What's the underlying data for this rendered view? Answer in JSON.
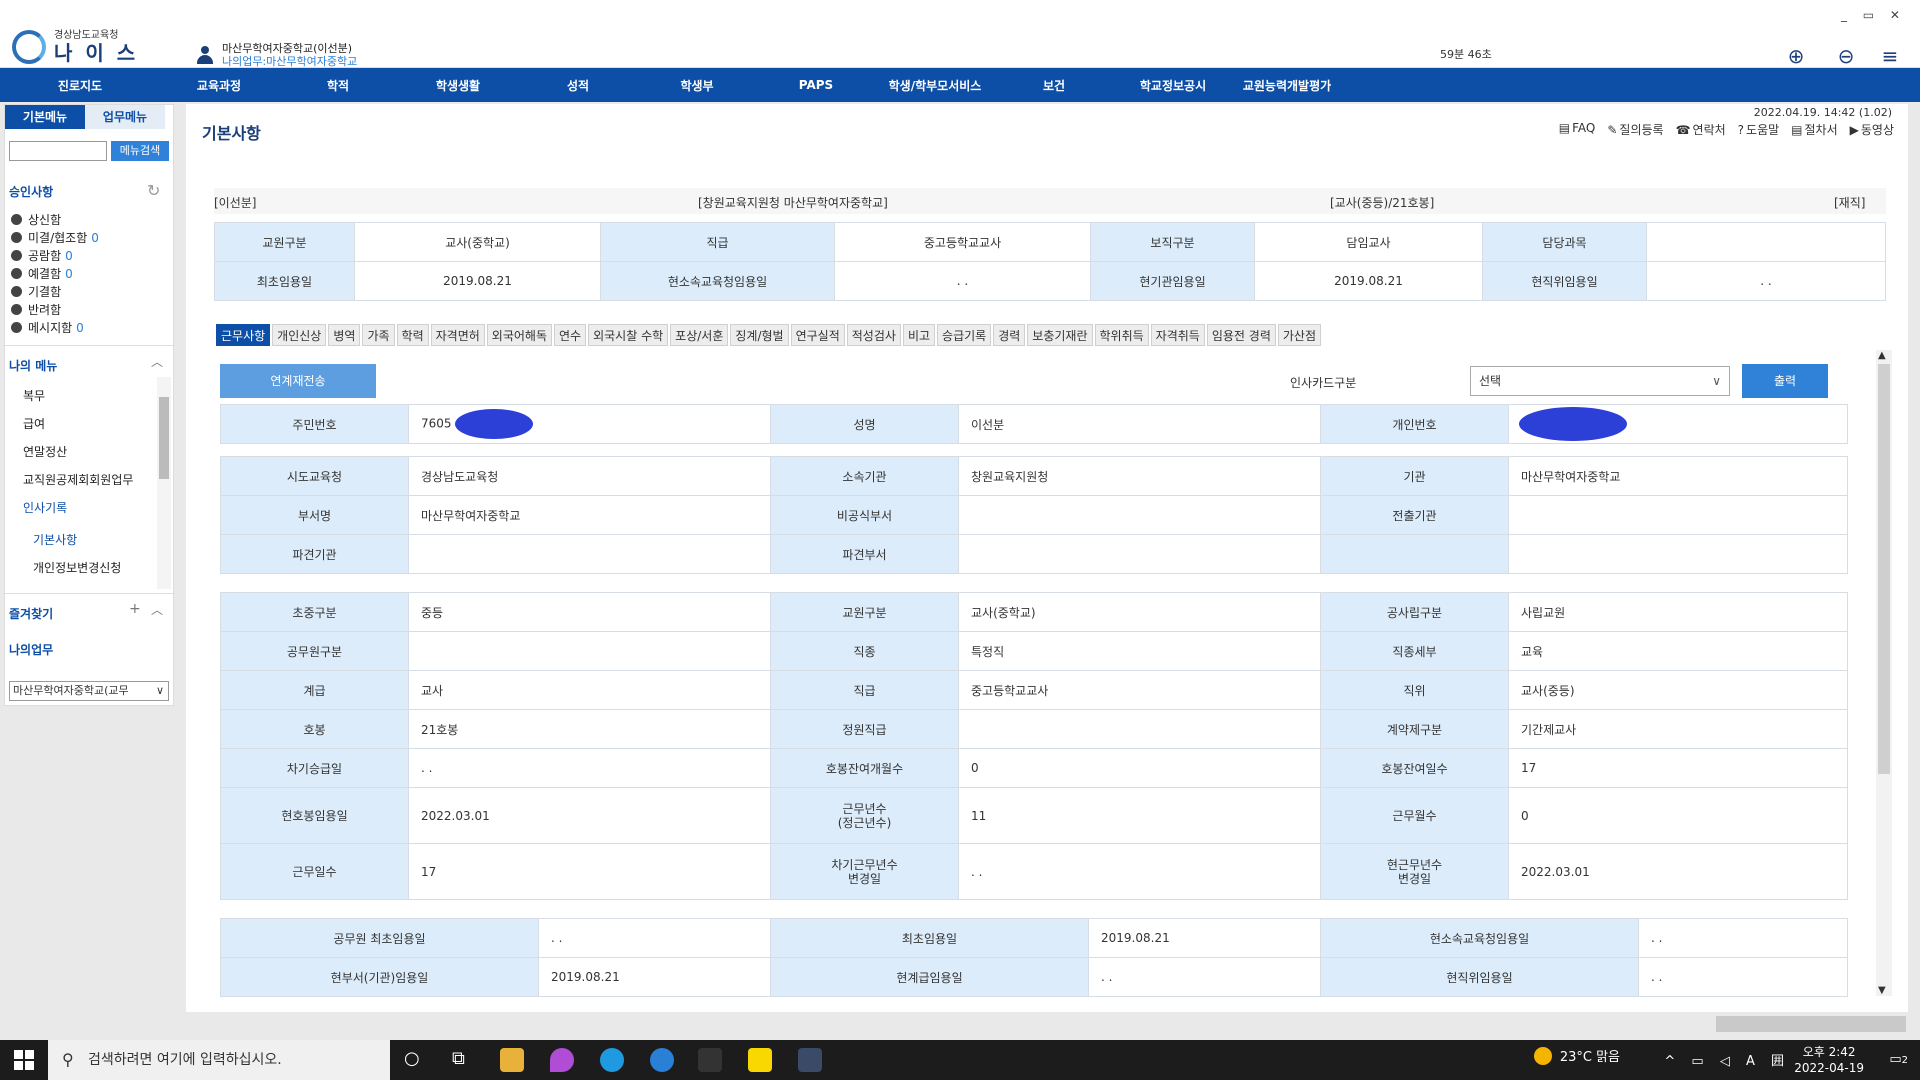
{
  "header": {
    "org": "경상남도교육청",
    "system_name": "나 이 스",
    "user_line1": "마산무학여자중학교(이선분)",
    "user_line2": "나의업무:마산무학여자중학교",
    "session_timer": "59분 46초",
    "window_controls": "_ ▭ ✕"
  },
  "nav": [
    "진로지도",
    "교육과정",
    "학적",
    "학생생활",
    "성적",
    "학생부",
    "PAPS",
    "학생/학부모서비스",
    "보건",
    "학교정보공시",
    "교원능력개발평가"
  ],
  "sidebar": {
    "tab_basic": "기본메뉴",
    "tab_work": "업무메뉴",
    "search_button": "메뉴검색",
    "approval_title": "승인사항",
    "approvals": [
      {
        "label": "상신함",
        "count": ""
      },
      {
        "label": "미결/협조함",
        "count": "0"
      },
      {
        "label": "공람함",
        "count": "0"
      },
      {
        "label": "예결함",
        "count": "0"
      },
      {
        "label": "기결함",
        "count": ""
      },
      {
        "label": "반려함",
        "count": ""
      },
      {
        "label": "메시지함",
        "count": "0"
      }
    ],
    "my_menu_title": "나의 메뉴",
    "my_menu": [
      "복무",
      "급여",
      "연말정산",
      "교직원공제회회원업무"
    ],
    "hr_record": "인사기록",
    "hr_sub": [
      "기본사항",
      "개인정보변경신청"
    ],
    "favorites": "즐겨찾기",
    "my_work": "나의업무",
    "dept_select": "마산무학여자중학교(교무"
  },
  "content": {
    "title": "기본사항",
    "datetime": "2022.04.19. 14:42 (1.02)",
    "links": [
      "FAQ",
      "질의등록",
      "연락처",
      "도움말",
      "절차서",
      "동영상"
    ],
    "info": {
      "name": "[이선분]",
      "org": "[창원교육지원청 마산무학여자중학교]",
      "grade": "[교사(중등)/21호봉]",
      "status": "[재직]"
    },
    "summary": [
      [
        "교원구분",
        "교사(중학교)",
        "직급",
        "중고등학교교사",
        "보직구분",
        "담임교사",
        "담당과목",
        ""
      ],
      [
        "최초임용일",
        "2019.08.21",
        "현소속교육청임용일",
        ". .",
        "현기관임용일",
        "2019.08.21",
        "현직위임용일",
        ". ."
      ]
    ],
    "tabs": [
      "근무사항",
      "개인신상",
      "병역",
      "가족",
      "학력",
      "자격면허",
      "외국어해독",
      "연수",
      "외국시찰 수학",
      "포상/서훈",
      "징계/형벌",
      "연구실적",
      "적성검사",
      "비고",
      "승급기록",
      "경력",
      "보충기재란",
      "학위취득",
      "자격취득",
      "임용전 경력",
      "가산점"
    ],
    "link_button": "연계재전송",
    "card_label": "인사카드구분",
    "card_select": "선택",
    "print_button": "출력",
    "id_row": [
      "주민번호",
      "7605",
      "성명",
      "이선분",
      "개인번호",
      ""
    ],
    "org_rows": [
      [
        "시도교육청",
        "경상남도교육청",
        "소속기관",
        "창원교육지원청",
        "기관",
        "마산무학여자중학교"
      ],
      [
        "부서명",
        "마산무학여자중학교",
        "비공식부서",
        "",
        "전출기관",
        ""
      ],
      [
        "파견기관",
        "",
        "파견부서",
        "",
        "",
        ""
      ]
    ],
    "detail_rows": [
      [
        "초중구분",
        "중등",
        "교원구분",
        "교사(중학교)",
        "공사립구분",
        "사립교원"
      ],
      [
        "공무원구분",
        "",
        "직종",
        "특정직",
        "직종세부",
        "교육"
      ],
      [
        "계급",
        "교사",
        "직급",
        "중고등학교교사",
        "직위",
        "교사(중등)"
      ],
      [
        "호봉",
        "21호봉",
        "정원직급",
        "",
        "계약제구분",
        "기간제교사"
      ],
      [
        "차기승급일",
        ". .",
        "호봉잔여개월수",
        "0",
        "호봉잔여일수",
        "17"
      ],
      [
        "현호봉임용일",
        "2022.03.01",
        "근무년수\n(정근년수)",
        "11",
        "근무월수",
        "0"
      ],
      [
        "근무일수",
        "17",
        "차기근무년수\n변경일",
        ". .",
        "현근무년수\n변경일",
        "2022.03.01"
      ]
    ],
    "date_rows": [
      [
        "공무원 최초임용일",
        ". .",
        "최초임용일",
        "2019.08.21",
        "현소속교육청임용일",
        ". ."
      ],
      [
        "현부서(기관)임용일",
        "2019.08.21",
        "현계급임용일",
        ". .",
        "현직위임용일",
        ". ."
      ]
    ]
  },
  "taskbar": {
    "search_placeholder": "검색하려면 여기에 입력하십시오.",
    "weather": "23°C  맑음",
    "time": "오후 2:42",
    "date": "2022-04-19",
    "notif": "2"
  },
  "colors": {
    "nav": "#0d4ea6",
    "header_cell": "#dcecfa",
    "accent": "#2f82d8"
  }
}
